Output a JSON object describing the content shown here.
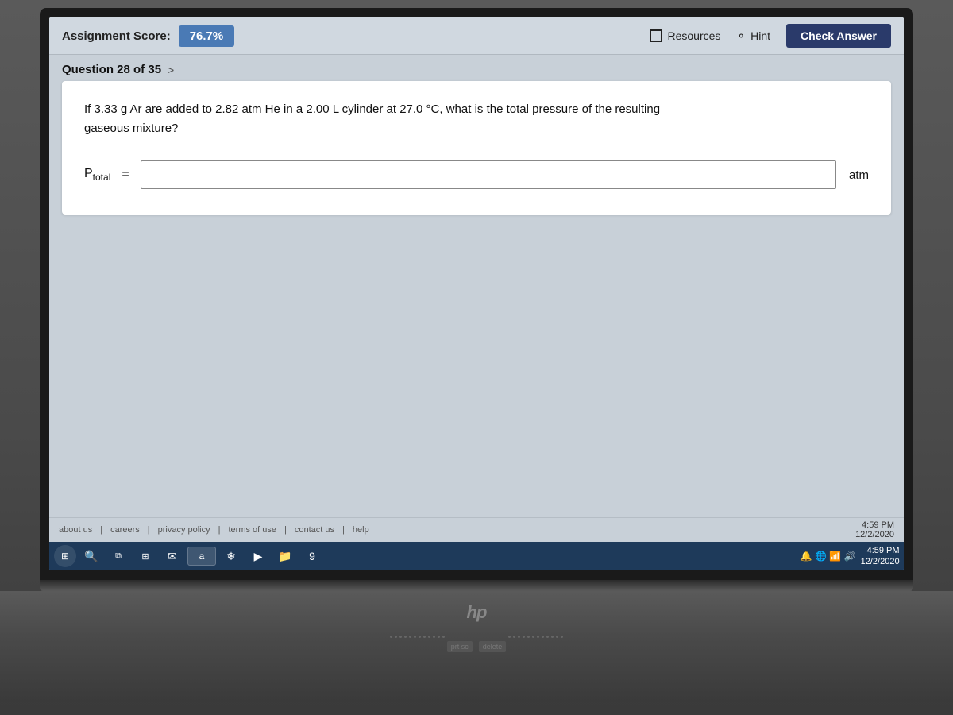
{
  "header": {
    "assignment_score_label": "Assignment Score:",
    "score_value": "76.7%",
    "resources_label": "Resources",
    "hint_label": "Hint",
    "check_answer_label": "Check Answer"
  },
  "question": {
    "number_label": "Question 28 of 35",
    "chevron": ">",
    "text_line1": "If 3.33 g Ar are added to 2.82 atm He in a 2.00 L cylinder at 27.0 °C, what is the total pressure of the resulting",
    "text_line2": "gaseous mixture?",
    "p_total_label": "P",
    "p_total_sub": "total",
    "equals": "=",
    "input_placeholder": "",
    "unit_label": "atm"
  },
  "footer": {
    "about_us": "about us",
    "careers": "careers",
    "privacy_policy": "privacy policy",
    "terms_of_use": "terms of use",
    "contact_us": "contact us",
    "help": "help",
    "time": "4:59 PM",
    "date": "12/2/2020"
  },
  "taskbar": {
    "start_icon": "⊞",
    "time": "4:59 PM",
    "date": "12/2/2020"
  },
  "laptop": {
    "brand": "hp"
  },
  "keyboard": {
    "prt_sc": "prt sc",
    "delete": "delete"
  }
}
